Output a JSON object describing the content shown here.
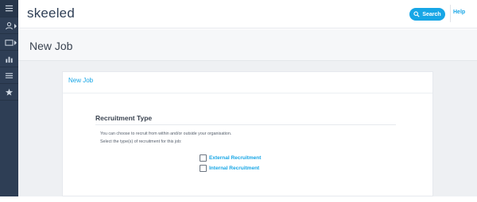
{
  "app": {
    "logo_text": "skeeled",
    "accent_color": "#17a6e6",
    "sidebar_color": "#2e3e55"
  },
  "sidebar": {
    "items": [
      {
        "icon": "hamburger-menu-icon"
      },
      {
        "icon": "user-icon",
        "has_submenu": true
      },
      {
        "icon": "video-icon",
        "has_submenu": true
      },
      {
        "icon": "bar-chart-icon"
      },
      {
        "icon": "list-icon"
      },
      {
        "icon": "star-icon"
      }
    ]
  },
  "topbar": {
    "search_label": "Search",
    "help_label": "Help"
  },
  "page": {
    "title": "New Job"
  },
  "card": {
    "title": "New Job",
    "section_title": "Recruitment Type",
    "description_line1": "You can choose to recruit from within and/or outside your organisation.",
    "description_line2": "Select the type(s) of recruitment for this job:",
    "options": [
      {
        "label": "External Recruitment",
        "checked": false
      },
      {
        "label": "Internal Recruitment",
        "checked": false
      }
    ]
  }
}
